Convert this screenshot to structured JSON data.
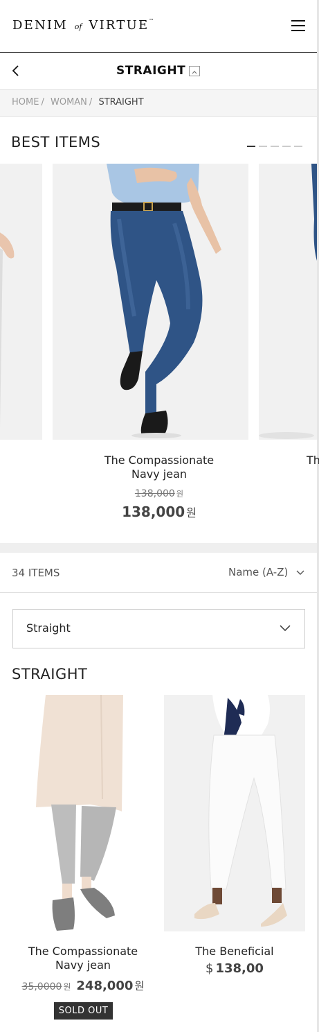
{
  "header": {
    "logo_left": "DENIM",
    "logo_of": "of",
    "logo_right": "VIRTUE",
    "logo_tm": "™"
  },
  "subheader": {
    "title": "STRAIGHT"
  },
  "breadcrumb": {
    "items": [
      "HOME",
      "WOMAN",
      "STRAIGHT"
    ],
    "separator": "/"
  },
  "best_items": {
    "title": "BEST ITEMS",
    "pager_count": 5,
    "pager_active": 1,
    "featured": {
      "name_line1": "The Compassionate",
      "name_line2": "Navy jean",
      "old_price": "138,000",
      "price": "138,000",
      "currency_unit": "원"
    },
    "next_name_partial": "Th"
  },
  "toolbar": {
    "item_count": "34 ITEMS",
    "sort_value": "Name (A-Z)"
  },
  "category_filter": {
    "value": "Straight"
  },
  "section": {
    "title": "STRAIGHT"
  },
  "products": [
    {
      "name_line1": "The Compassionate",
      "name_line2": "Navy jean",
      "old_price": "35,0000",
      "price": "248,000",
      "currency_unit": "원",
      "badge": "SOLD OUT"
    },
    {
      "name_line1": "The Beneficial",
      "currency_symbol": "$",
      "price": "138,00"
    }
  ],
  "colors": {
    "text": "#222222",
    "muted": "#9a9a9a",
    "badge_bg": "#333333",
    "band": "#efefef",
    "denim": "#2f5486"
  }
}
